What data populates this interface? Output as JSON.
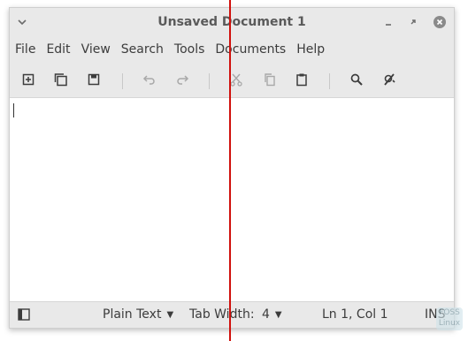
{
  "window": {
    "title": "Unsaved Document 1"
  },
  "menu": {
    "items": [
      "File",
      "Edit",
      "View",
      "Search",
      "Tools",
      "Documents",
      "Help"
    ]
  },
  "toolbar": {
    "icons": [
      "new-document-icon",
      "open-icon",
      "save-icon",
      "undo-icon",
      "redo-icon",
      "cut-icon",
      "copy-icon",
      "paste-icon",
      "search-icon",
      "replace-icon"
    ]
  },
  "statusbar": {
    "language": "Plain Text",
    "tab_width_label": "Tab Width:",
    "tab_width_value": "4",
    "position": "Ln 1, Col 1",
    "mode": "INS"
  },
  "watermark": {
    "line1": "FOSS",
    "line2": "Linux"
  },
  "colors": {
    "accent_line": "#d0100c",
    "window_bg": "#e9e9e9",
    "editor_bg": "#ffffff"
  }
}
